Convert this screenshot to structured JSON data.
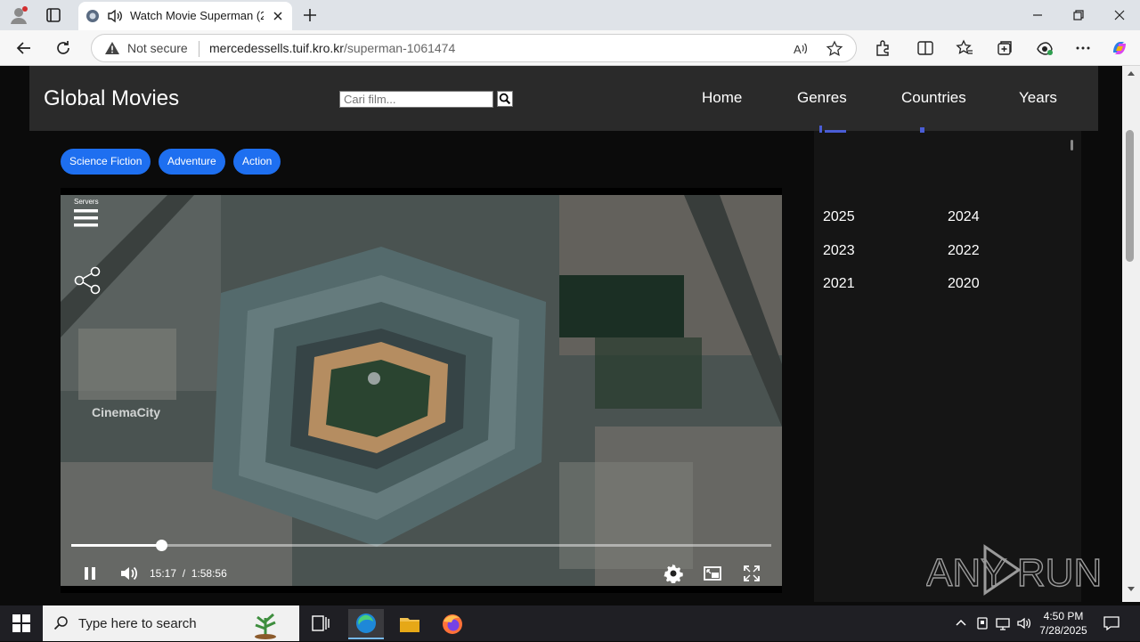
{
  "browser": {
    "tab_title": "Watch Movie Superman (2025",
    "address": {
      "security_label": "Not secure",
      "host": "mercedessells.tuif.kro.kr",
      "path": "/superman-1061474"
    }
  },
  "site": {
    "logo": "Global Movies",
    "search_placeholder": "Cari film...",
    "nav": [
      "Home",
      "Genres",
      "Countries",
      "Years"
    ]
  },
  "genres": [
    "Science Fiction",
    "Adventure",
    "Action"
  ],
  "player": {
    "servers_label": "Servers",
    "watermark": "CinemaCity",
    "current_time": "15:17",
    "separator": "/",
    "duration": "1:58:56",
    "progress": 0.1287,
    "state": "playing"
  },
  "sidebar": {
    "years": [
      "2025",
      "2024",
      "2023",
      "2022",
      "2021",
      "2020"
    ]
  },
  "overlay": {
    "watermark": "ANY RUN"
  },
  "taskbar": {
    "search_placeholder": "Type here to search",
    "time": "4:50 PM",
    "date": "7/28/2025"
  },
  "colors": {
    "genre_pill": "#1e6ff0",
    "site_header": "#2a2a2a",
    "page_bg": "#0b0b0b",
    "sidebar_bg": "#151515"
  }
}
